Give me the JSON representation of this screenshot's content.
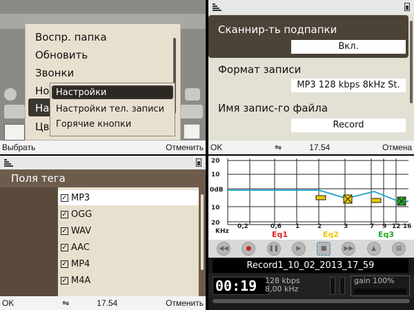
{
  "panel1": {
    "menu_items": [
      "Воспр. папка",
      "Обновить",
      "Звонки",
      "Но",
      "На",
      "Цв"
    ],
    "submenu_items": [
      "Настройки",
      "Настройки тел. записи",
      "Горячие кнопки"
    ],
    "softkeys": {
      "left": "Выбрать",
      "right": "Отменить"
    }
  },
  "panel2": {
    "fields": [
      {
        "label": "Сканнир-ть подпапки",
        "value": "Вкл."
      },
      {
        "label": "Формат записи",
        "value": "MP3 128 kbps 8kHz St."
      },
      {
        "label": "Имя запис-го файла",
        "value": "Record"
      }
    ],
    "softkeys": {
      "left": "OK",
      "time": "17.54",
      "right": "Отмена"
    }
  },
  "panel3": {
    "title": "Поля тега",
    "tags": [
      "MP3",
      "OGG",
      "WAV",
      "AAC",
      "MP4",
      "M4A"
    ],
    "softkeys": {
      "left": "OK",
      "time": "17.54",
      "right": "Отменить"
    }
  },
  "panel4": {
    "y_labels": [
      "20",
      "10",
      "0dB",
      "10",
      "20"
    ],
    "khz_label": "KHz",
    "freq_labels": [
      "0,2",
      "0,6",
      "1",
      "2",
      "3",
      "7",
      "9",
      "12",
      "16"
    ],
    "eq_labels": [
      "Eq1",
      "Eq2",
      "Eq3"
    ],
    "filename": "Record1_10_02_2013_17_59",
    "timer": "00:19",
    "bitrate": "128 kbps",
    "samplerate": "8,00 kHz",
    "gain": "gain 100%"
  },
  "colors": {
    "eq_line": "#2aa6c9",
    "eq1": "#dd2222",
    "eq2": "#e8c800",
    "eq3": "#22aa22"
  },
  "icons": {
    "signal": "signal-bars-icon",
    "battery": "battery-icon",
    "bluetooth": "bluetooth-icon"
  }
}
